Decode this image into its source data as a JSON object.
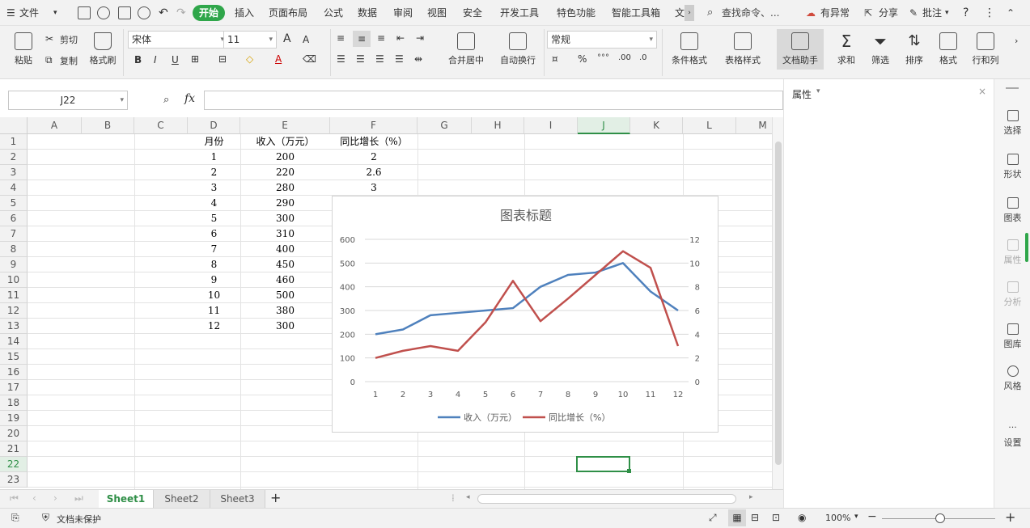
{
  "menu": {
    "file": "文件",
    "tabs": [
      "开始",
      "插入",
      "页面布局",
      "公式",
      "数据",
      "审阅",
      "视图",
      "安全",
      "开发工具",
      "特色功能",
      "智能工具箱",
      "文"
    ],
    "search": "查找命令、...",
    "right_items": [
      "有异常",
      "分享",
      "批注"
    ]
  },
  "ribbon": {
    "paste": "粘贴",
    "cut": "剪切",
    "copy": "复制",
    "format_painter": "格式刷",
    "font_name": "宋体",
    "font_size": "11",
    "merge_center": "合并居中",
    "wrap_text": "自动换行",
    "number_format": "常规",
    "conditional_format": "条件格式",
    "table_style": "表格样式",
    "doc_assistant": "文档助手",
    "sum": "求和",
    "filter": "筛选",
    "sort": "排序",
    "format": "格式",
    "row_col": "行和列"
  },
  "formula_bar": {
    "cell_ref": "J22",
    "fx": "fx",
    "formula": ""
  },
  "grid": {
    "columns": [
      "A",
      "B",
      "C",
      "D",
      "E",
      "F",
      "G",
      "H",
      "I",
      "J",
      "K",
      "L",
      "M"
    ],
    "selected_column": "J",
    "selected_row": "22",
    "rows": [
      "1",
      "2",
      "3",
      "4",
      "5",
      "6",
      "7",
      "8",
      "9",
      "10",
      "11",
      "12",
      "13",
      "14",
      "15",
      "16",
      "17",
      "18",
      "19",
      "20",
      "21",
      "22",
      "23"
    ],
    "table": {
      "headers": [
        "月份",
        "收入（万元）",
        "同比增长（%）"
      ],
      "months": [
        "1",
        "2",
        "3",
        "4",
        "5",
        "6",
        "7",
        "8",
        "9",
        "10",
        "11",
        "12"
      ],
      "revenue": [
        "200",
        "220",
        "280",
        "290",
        "300",
        "310",
        "400",
        "450",
        "460",
        "500",
        "380",
        "300"
      ],
      "growth": [
        "2",
        "2.6",
        "3"
      ]
    }
  },
  "chart_data": {
    "type": "line",
    "title": "图表标题",
    "categories": [
      "1",
      "2",
      "3",
      "4",
      "5",
      "6",
      "7",
      "8",
      "9",
      "10",
      "11",
      "12"
    ],
    "y_left": {
      "min": 0,
      "max": 600,
      "ticks": [
        "0",
        "100",
        "200",
        "300",
        "400",
        "500",
        "600"
      ]
    },
    "y_right": {
      "min": 0,
      "max": 12,
      "ticks": [
        "0",
        "2",
        "4",
        "6",
        "8",
        "10",
        "12"
      ]
    },
    "series": [
      {
        "name": "收入（万元）",
        "axis": "left",
        "color": "#4f81bd",
        "values": [
          200,
          220,
          280,
          290,
          300,
          310,
          400,
          450,
          460,
          500,
          380,
          300
        ]
      },
      {
        "name": "同比增长（%）",
        "axis": "right",
        "color": "#c0504d",
        "values": [
          2,
          2.6,
          3,
          2.6,
          5,
          8.5,
          5.1,
          7,
          9,
          11,
          9.6,
          3
        ]
      }
    ],
    "grid": true,
    "legend": "bottom"
  },
  "right_panel": {
    "title": "属性",
    "tools": [
      "选择",
      "形状",
      "图表",
      "属性",
      "分析",
      "图库",
      "风格",
      "设置"
    ]
  },
  "sheets": [
    "Sheet1",
    "Sheet2",
    "Sheet3"
  ],
  "active_sheet": "Sheet1",
  "status": {
    "protect": "文档未保护",
    "zoom": "100%"
  },
  "colors": {
    "accent": "#2fa64a",
    "selected": "#2f8f47"
  }
}
